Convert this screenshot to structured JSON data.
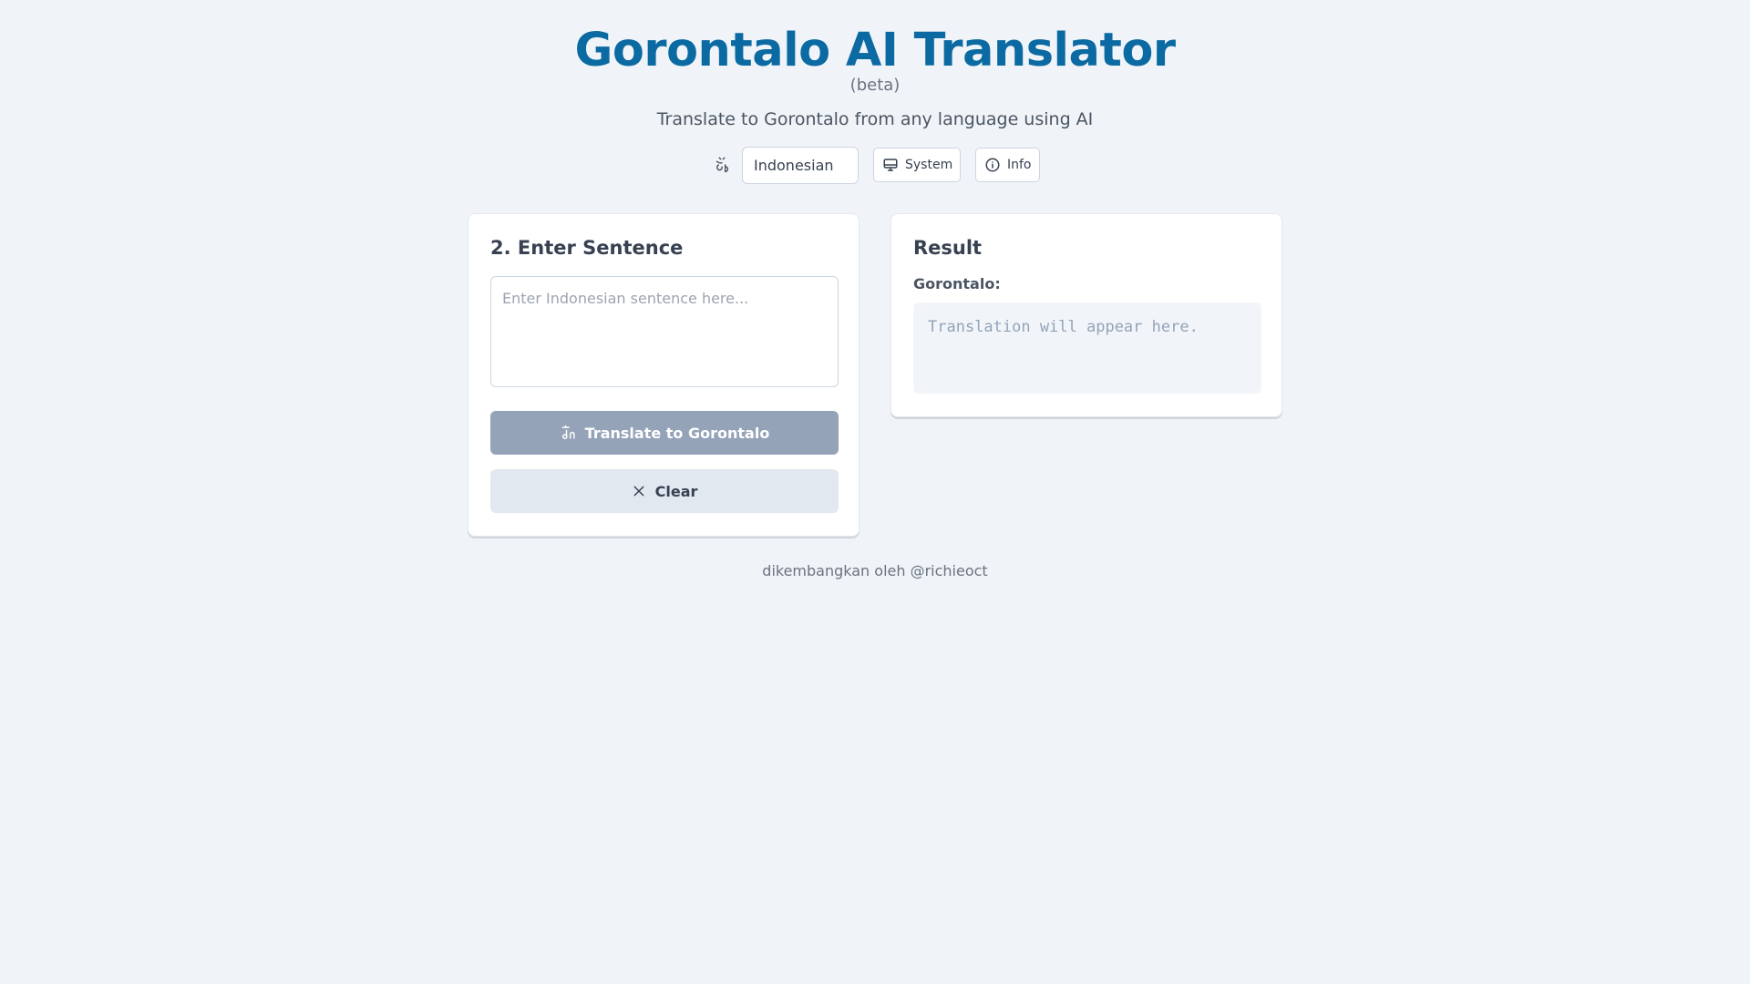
{
  "header": {
    "title": "Gorontalo AI Translator",
    "beta": "(beta)",
    "subtitle": "Translate to Gorontalo from any language using AI"
  },
  "controls": {
    "language_icon": "language-icon",
    "source_language": "Indonesian",
    "system_label": "System",
    "system_icon": "monitor-icon",
    "info_label": "Info",
    "info_icon": "info-icon"
  },
  "input_card": {
    "title": "2. Enter Sentence",
    "placeholder": "Enter Indonesian sentence here...",
    "value": "",
    "translate_label": "Translate to Gorontalo",
    "translate_icon": "translate-icon",
    "clear_label": "Clear",
    "clear_icon": "close-icon"
  },
  "result_card": {
    "title": "Result",
    "label": "Gorontalo:",
    "placeholder": "Translation will appear here."
  },
  "footer": {
    "text": "dikembangkan oleh @richieoct"
  },
  "colors": {
    "background": "#f0f4f8",
    "title": "#0b6aa2",
    "primary_button_disabled": "#94a3b8",
    "secondary_button": "#e2e8f0",
    "result_box": "#f1f5f9"
  }
}
